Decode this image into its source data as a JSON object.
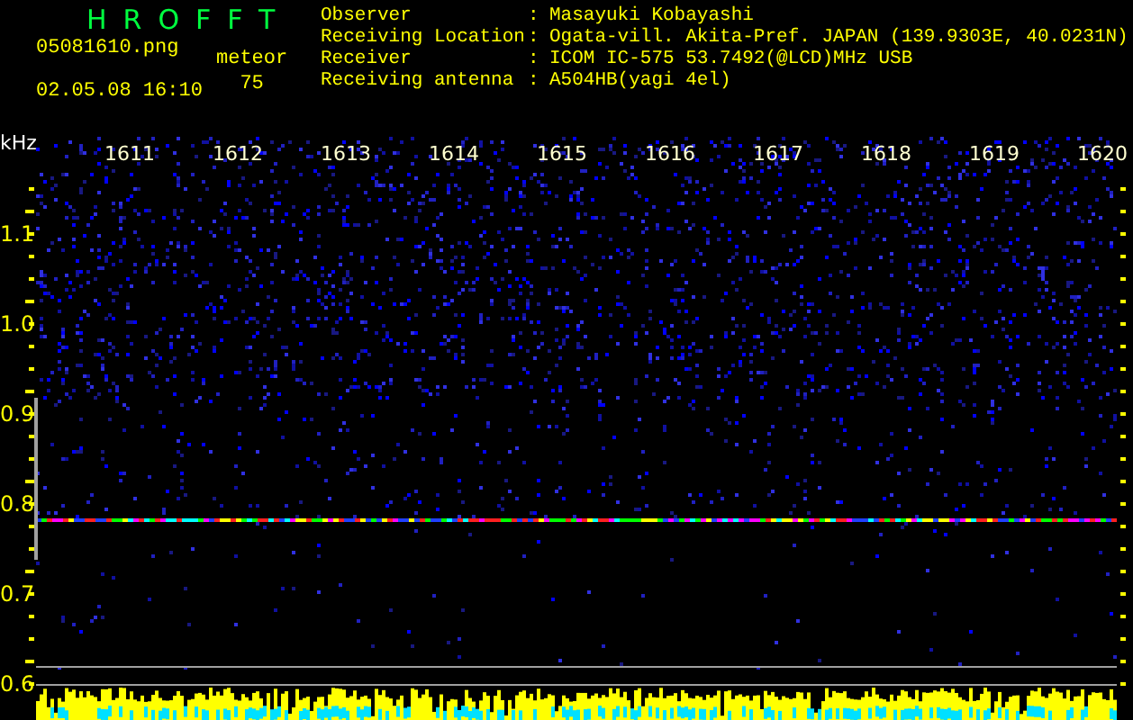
{
  "app_title": "HROFFT",
  "file_name": "05081610.png",
  "timestamp": "02.05.08 16:10",
  "meteor_label": "meteor",
  "meteor_count": "75",
  "info": [
    {
      "label": "Observer",
      "separator": ":",
      "value": "Masayuki Kobayashi"
    },
    {
      "label": "Receiving Location",
      "separator": ":",
      "value": "Ogata-vill. Akita-Pref. JAPAN (139.9303E, 40.0231N)"
    },
    {
      "label": "Receiver",
      "separator": ":",
      "value": "ICOM IC-575 53.7492(@LCD)MHz USB"
    },
    {
      "label": "Receiving antenna",
      "separator": ":",
      "value": "A504HB(yagi 4el)"
    }
  ],
  "spectrogram": {
    "y_unit": "kHz",
    "y_labels": [
      "1.1",
      "1.0",
      "0.9",
      "0.8",
      "0.7",
      "0.6"
    ],
    "time_labels": [
      "1611",
      "1612",
      "1613",
      "1614",
      "1615",
      "1616",
      "1617",
      "1618",
      "1619",
      "1620"
    ]
  }
}
